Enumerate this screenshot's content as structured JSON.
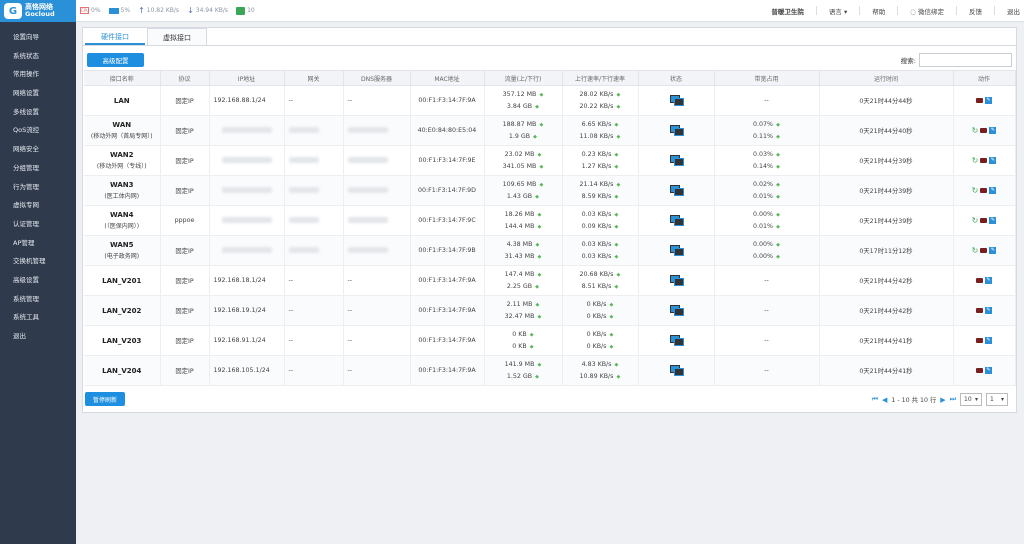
{
  "brand": {
    "logo_cn": "高恪网络",
    "logo_en": "Gocloud",
    "logo_mark": "G"
  },
  "sidebar": {
    "items": [
      "设置向导",
      "系统状态",
      "常用操作",
      "网络设置",
      "多线设置",
      "QoS流控",
      "网络安全",
      "分组管理",
      "行为管理",
      "虚拟专网",
      "认证管理",
      "AP管理",
      "交换机管理",
      "高级设置",
      "系统管理",
      "系统工具",
      "退出"
    ]
  },
  "topbar": {
    "cpu": "0%",
    "mem": "5%",
    "up": "10.82 KB/s",
    "down": "34.94 KB/s",
    "users": "10",
    "org": "普暖卫生院",
    "language": "语言",
    "help": "帮助",
    "wechat": "微信绑定",
    "feedback": "反馈",
    "logout": "退出"
  },
  "tabs": [
    "硬件接口",
    "虚拟接口"
  ],
  "buttons": {
    "advanced": "高级配置",
    "pause": "暂停刷新"
  },
  "search": {
    "label": "搜索:",
    "placeholder": ""
  },
  "table": {
    "columns": [
      "接口名称",
      "协议",
      "IP地址",
      "网关",
      "DNS服务器",
      "MAC地址",
      "流量(上/下行)",
      "上行速率/下行速率",
      "状态",
      "带宽占用",
      "运行时间",
      "动作"
    ],
    "rows": [
      {
        "name": "LAN",
        "sub": "",
        "proto": "固定IP",
        "ip": "192.168.88.1/24",
        "gw": "--",
        "dns": "--",
        "mac": "00:F1:F3:14:7F:9A",
        "tr_up": "357.12 MB",
        "tr_down": "3.84 GB",
        "sp_up": "28.02 KB/s",
        "sp_down": "20.22 KB/s",
        "bw1": "--",
        "bw2": "",
        "uptime": "0天21时44分44秒"
      },
      {
        "name": "WAN",
        "sub": "(移动外网（首局专网）)",
        "proto": "固定IP",
        "ip": "",
        "gw": "",
        "dns": "",
        "mac": "40:E0:84:80:E5:04",
        "tr_up": "188.87 MB",
        "tr_down": "1.9 GB",
        "sp_up": "6.65 KB/s",
        "sp_down": "11.08 KB/s",
        "bw1": "0.07%",
        "bw2": "0.11%",
        "uptime": "0天21时44分40秒"
      },
      {
        "name": "WAN2",
        "sub": "(移动外网（专线）)",
        "proto": "固定IP",
        "ip": "",
        "gw": "",
        "dns": "",
        "mac": "00:F1:F3:14:7F:9E",
        "tr_up": "23.02 MB",
        "tr_down": "341.05 MB",
        "sp_up": "0.23 KB/s",
        "sp_down": "1.27 KB/s",
        "bw1": "0.03%",
        "bw2": "0.14%",
        "uptime": "0天21时44分39秒"
      },
      {
        "name": "WAN3",
        "sub": "(医工体内网)",
        "proto": "固定IP",
        "ip": "",
        "gw": "",
        "dns": "",
        "mac": "00:F1:F3:14:7F:9D",
        "tr_up": "109.65 MB",
        "tr_down": "1.43 GB",
        "sp_up": "21.14 KB/s",
        "sp_down": "8.59 KB/s",
        "bw1": "0.02%",
        "bw2": "0.01%",
        "uptime": "0天21时44分39秒"
      },
      {
        "name": "WAN4",
        "sub": "(（医保内网）)",
        "proto": "pppoe",
        "ip": "",
        "gw": "",
        "dns": "",
        "mac": "00:F1:F3:14:7F:9C",
        "tr_up": "18.26 MB",
        "tr_down": "144.4 MB",
        "sp_up": "0.03 KB/s",
        "sp_down": "0.09 KB/s",
        "bw1": "0.00%",
        "bw2": "0.01%",
        "uptime": "0天21时44分39秒"
      },
      {
        "name": "WAN5",
        "sub": "(电子政务网)",
        "proto": "固定IP",
        "ip": "",
        "gw": "",
        "dns": "",
        "mac": "00:F1:F3:14:7F:9B",
        "tr_up": "4.38 MB",
        "tr_down": "31.43 MB",
        "sp_up": "0.03 KB/s",
        "sp_down": "0.03 KB/s",
        "bw1": "0.00%",
        "bw2": "0.00%",
        "uptime": "0天17时11分12秒"
      },
      {
        "name": "LAN_V201",
        "sub": "",
        "proto": "固定IP",
        "ip": "192.168.18.1/24",
        "gw": "--",
        "dns": "--",
        "mac": "00:F1:F3:14:7F:9A",
        "tr_up": "147.4 MB",
        "tr_down": "2.25 GB",
        "sp_up": "20.68 KB/s",
        "sp_down": "8.51 KB/s",
        "bw1": "--",
        "bw2": "",
        "uptime": "0天21时44分42秒"
      },
      {
        "name": "LAN_V202",
        "sub": "",
        "proto": "固定IP",
        "ip": "192.168.19.1/24",
        "gw": "--",
        "dns": "--",
        "mac": "00:F1:F3:14:7F:9A",
        "tr_up": "2.11 MB",
        "tr_down": "32.47 MB",
        "sp_up": "0 KB/s",
        "sp_down": "0 KB/s",
        "bw1": "--",
        "bw2": "",
        "uptime": "0天21时44分42秒"
      },
      {
        "name": "LAN_V203",
        "sub": "",
        "proto": "固定IP",
        "ip": "192.168.91.1/24",
        "gw": "--",
        "dns": "--",
        "mac": "00:F1:F3:14:7F:9A",
        "tr_up": "0 KB",
        "tr_down": "0 KB",
        "sp_up": "0 KB/s",
        "sp_down": "0 KB/s",
        "bw1": "--",
        "bw2": "",
        "uptime": "0天21时44分41秒"
      },
      {
        "name": "LAN_V204",
        "sub": "",
        "proto": "固定IP",
        "ip": "192.168.105.1/24",
        "gw": "--",
        "dns": "--",
        "mac": "00:F1:F3:14:7F:9A",
        "tr_up": "141.9 MB",
        "tr_down": "1.52 GB",
        "sp_up": "4.83 KB/s",
        "sp_down": "10.89 KB/s",
        "bw1": "--",
        "bw2": "",
        "uptime": "0天21时44分41秒"
      }
    ]
  },
  "pager": {
    "info": "1 - 10 共 10 行",
    "page_size": "10",
    "page": "1"
  }
}
